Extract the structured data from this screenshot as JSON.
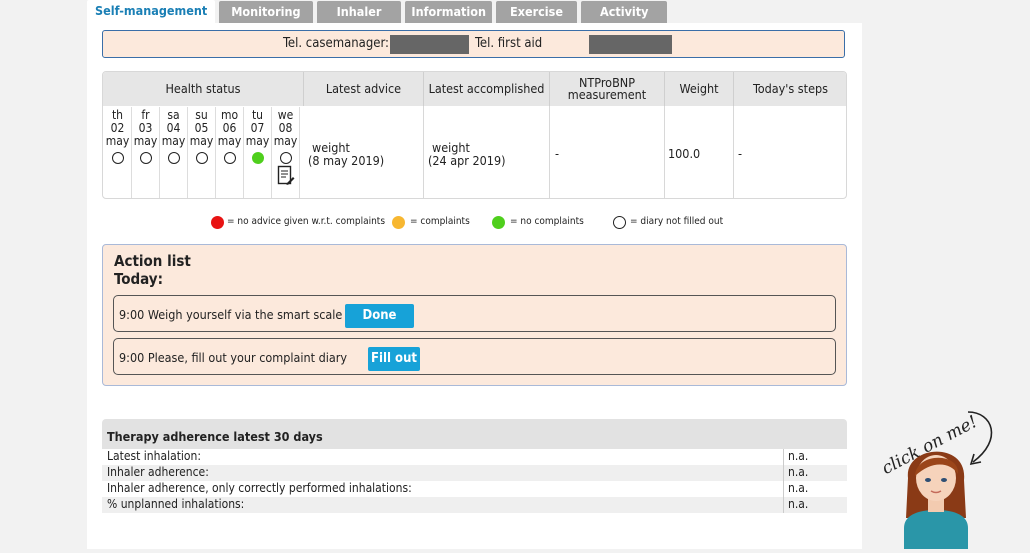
{
  "tabs": [
    "Self-management",
    "Monitoring",
    "Inhaler",
    "Information",
    "Exercise",
    "Activity"
  ],
  "contact": {
    "casemanager_label": "Tel. casemanager:",
    "firstaid_label": "Tel. first aid"
  },
  "health": {
    "headers": {
      "status": "Health status",
      "advice": "Latest advice",
      "accomplished": "Latest accomplished",
      "ntprobnp": "NTProBNP measurement",
      "weight": "Weight",
      "steps": "Today's steps"
    },
    "days": [
      {
        "dow": "th",
        "date": "02",
        "month": "may",
        "status": "diary not filled out"
      },
      {
        "dow": "fr",
        "date": "03",
        "month": "may",
        "status": "diary not filled out"
      },
      {
        "dow": "sa",
        "date": "04",
        "month": "may",
        "status": "diary not filled out"
      },
      {
        "dow": "su",
        "date": "05",
        "month": "may",
        "status": "diary not filled out"
      },
      {
        "dow": "mo",
        "date": "06",
        "month": "may",
        "status": "diary not filled out"
      },
      {
        "dow": "tu",
        "date": "07",
        "month": "may",
        "status": "no complaints"
      },
      {
        "dow": "we",
        "date": "08",
        "month": "may",
        "status": "diary not filled out"
      }
    ],
    "advice": {
      "name": "weight",
      "date": "(8 may 2019)"
    },
    "accomplished": {
      "name": "weight",
      "date": "(24 apr 2019)"
    },
    "ntprobnp": "-",
    "weight": "100.0",
    "steps": "-"
  },
  "legend": [
    {
      "color": "#e81313",
      "text": "= no advice given w.r.t. complaints"
    },
    {
      "color": "#f7b731",
      "text": "= complaints"
    },
    {
      "color": "#4fcf1d",
      "text": "= no complaints"
    },
    {
      "color": "#ffffff",
      "text": "= diary not filled out"
    }
  ],
  "actions": {
    "title": "Action list",
    "subtitle": "Today:",
    "items": [
      {
        "text": "9:00 Weigh yourself via the smart scale",
        "button": "Done"
      },
      {
        "text": "9:00 Please, fill out your complaint diary",
        "button": "Fill out"
      }
    ]
  },
  "adherence": {
    "title": "Therapy adherence latest 30 days",
    "rows": [
      {
        "label": "Latest inhalation:",
        "value": "n.a."
      },
      {
        "label": "Inhaler adherence:",
        "value": "n.a."
      },
      {
        "label": "Inhaler adherence, only correctly performed inhalations:",
        "value": "n.a."
      },
      {
        "label": "% unplanned inhalations:",
        "value": "n.a."
      }
    ]
  },
  "avatar": {
    "callout": "click on me!"
  }
}
